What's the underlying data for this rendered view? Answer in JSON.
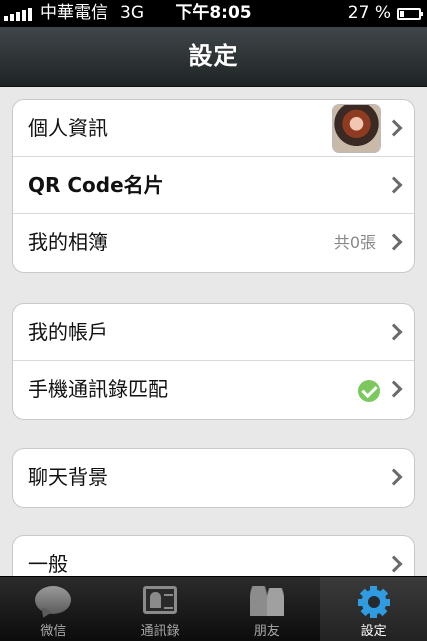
{
  "status_bar": {
    "carrier": "中華電信",
    "network": "3G",
    "time": "下午8:05",
    "battery_percent_text": "27 %",
    "battery_level": 0.27
  },
  "nav": {
    "title": "設定"
  },
  "groups": [
    {
      "rows": [
        {
          "label": "個人資訊",
          "accessory": "avatar"
        },
        {
          "label": "QR Code名片",
          "accessory": "chevron"
        },
        {
          "label": "我的相簿",
          "detail": "共0張",
          "accessory": "chevron"
        }
      ]
    },
    {
      "rows": [
        {
          "label": "我的帳戶",
          "accessory": "chevron"
        },
        {
          "label": "手機通訊錄匹配",
          "accessory": "check"
        }
      ]
    },
    {
      "rows": [
        {
          "label": "聊天背景",
          "accessory": "chevron"
        }
      ]
    },
    {
      "rows": [
        {
          "label": "一般",
          "accessory": "chevron"
        }
      ]
    }
  ],
  "tabs": [
    {
      "label": "微信",
      "icon": "chat-icon",
      "active": false
    },
    {
      "label": "通訊錄",
      "icon": "contacts-icon",
      "active": false
    },
    {
      "label": "朋友",
      "icon": "friends-icon",
      "active": false
    },
    {
      "label": "設定",
      "icon": "gear-icon",
      "active": true
    }
  ],
  "colors": {
    "active_tab_icon": "#2f9be0",
    "check_green": "#7cc85e"
  }
}
